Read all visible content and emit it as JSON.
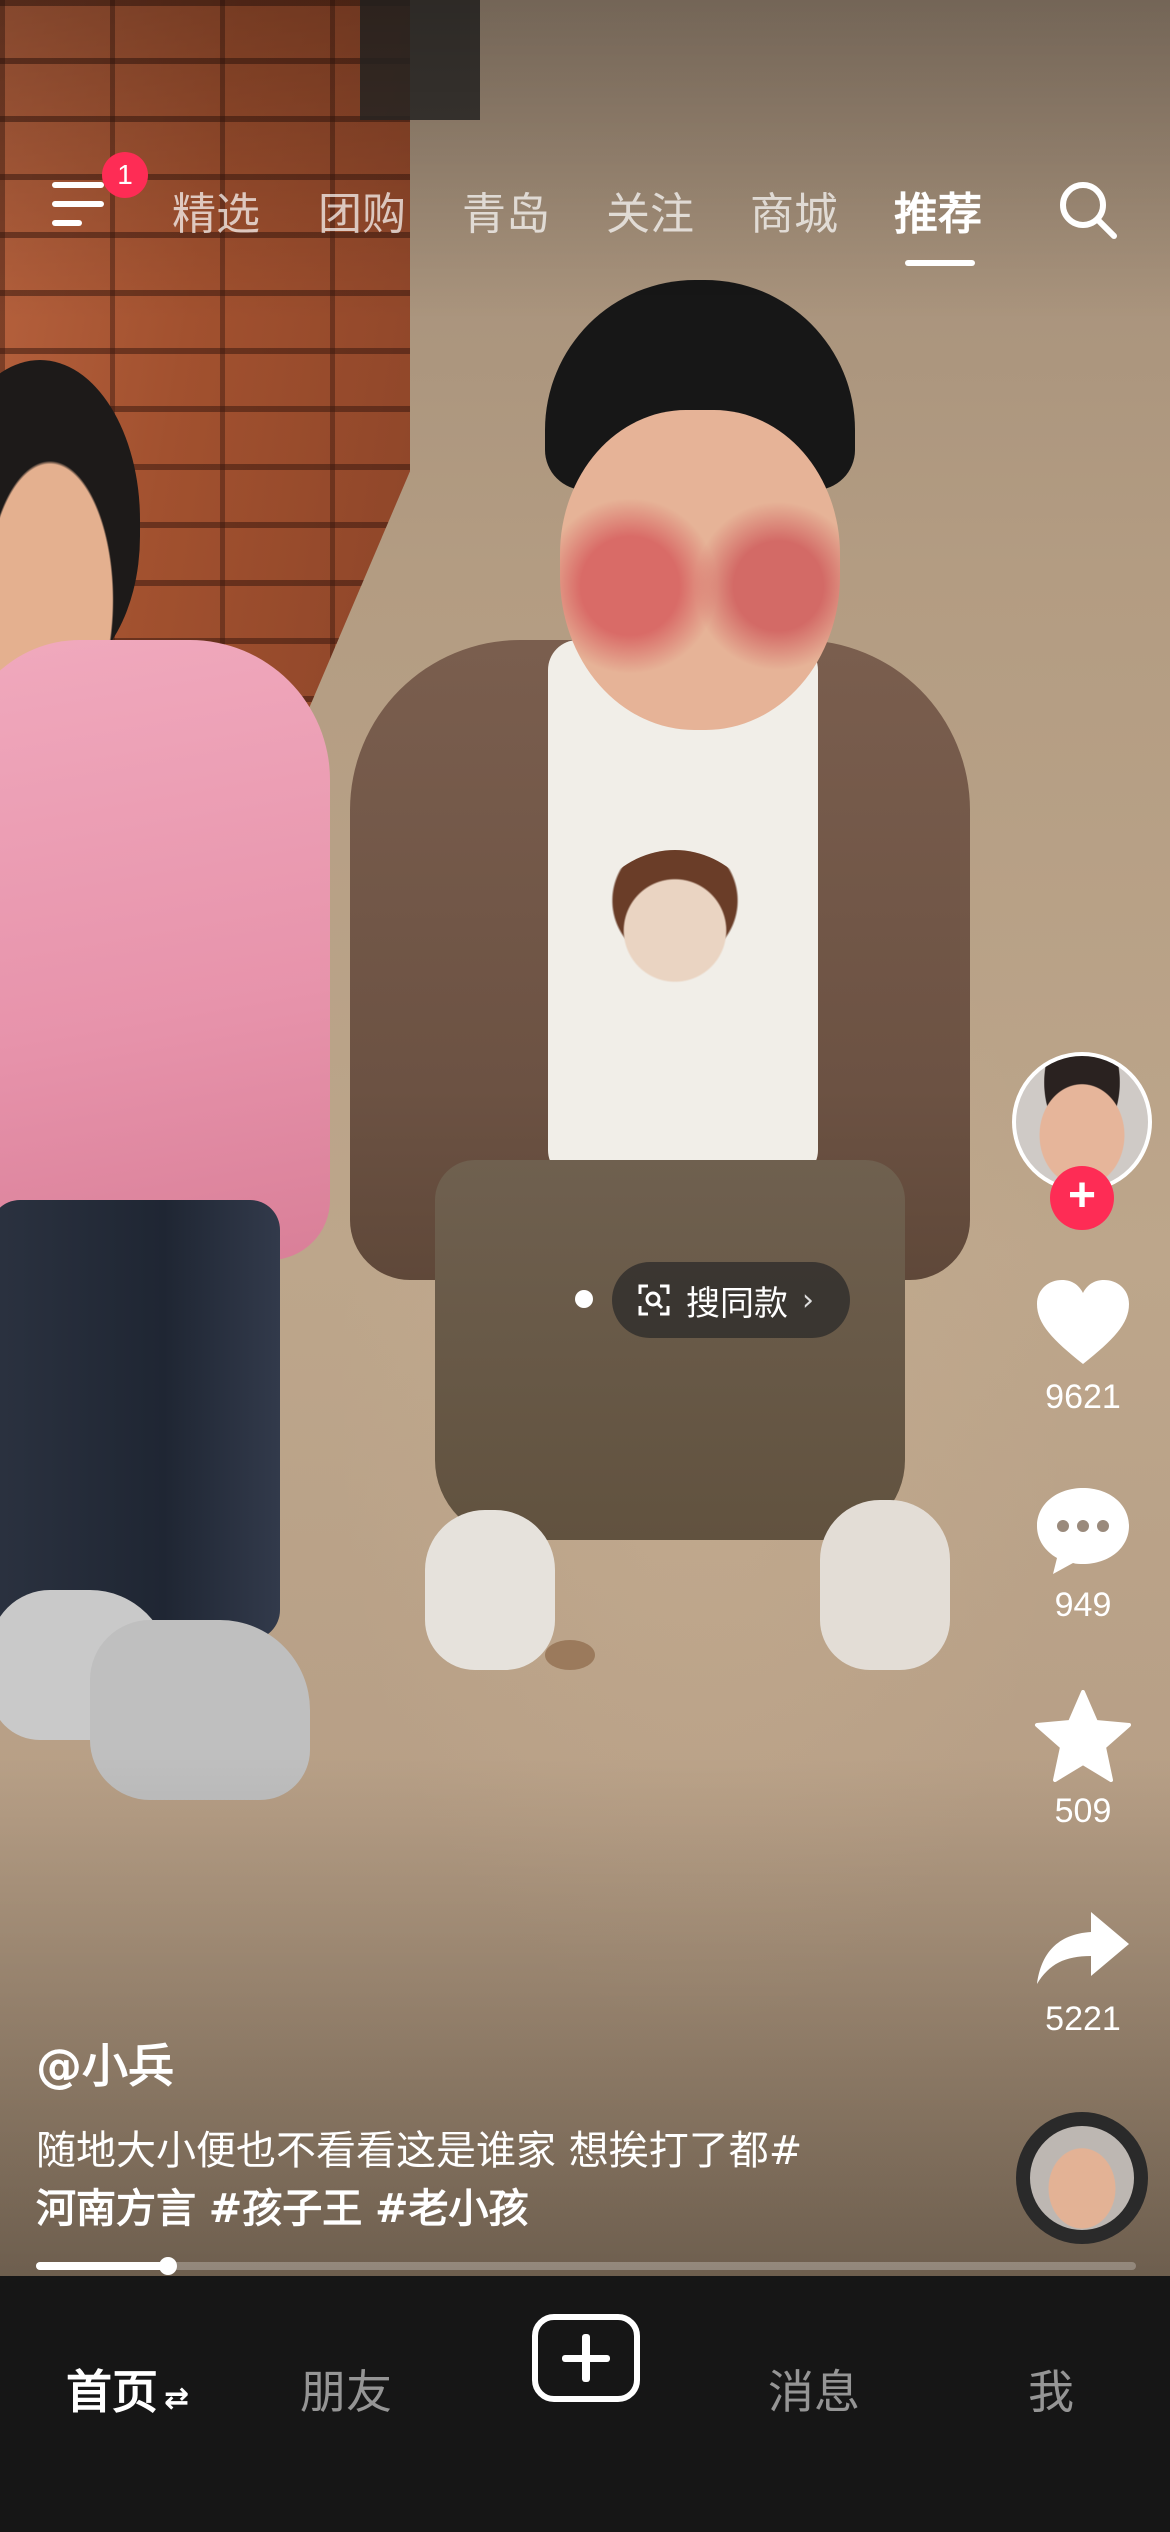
{
  "top_nav": {
    "menu_badge": "1",
    "tabs": [
      {
        "label": "精选"
      },
      {
        "label": "团购"
      },
      {
        "label": "青岛"
      },
      {
        "label": "关注"
      },
      {
        "label": "商城"
      },
      {
        "label": "推荐"
      }
    ],
    "active_tab": "推荐"
  },
  "video": {
    "search_same_label": "搜同款"
  },
  "actions": {
    "likes": "9621",
    "comments": "949",
    "favorites": "509",
    "shares": "5221"
  },
  "post": {
    "author": "@小兵",
    "caption_line1": "随地大小便也不看看这是谁家 想挨打了都#",
    "caption_line2_tag1": "河南方言",
    "caption_line2_tag2": "#孩子王",
    "caption_line2_tag3": "#老小孩",
    "progress": 0.12
  },
  "bottom_nav": {
    "home": "首页",
    "friends": "朋友",
    "messages": "消息",
    "me": "我"
  },
  "colors": {
    "accent": "#fe2c55",
    "tabbar_bg": "#161616"
  }
}
